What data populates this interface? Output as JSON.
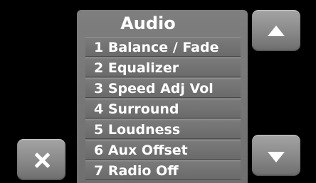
{
  "menu": {
    "title": "Audio",
    "items": [
      {
        "label": "1 Balance / Fade"
      },
      {
        "label": "2 Equalizer"
      },
      {
        "label": "3 Speed Adj Vol"
      },
      {
        "label": "4 Surround"
      },
      {
        "label": "5 Loudness"
      },
      {
        "label": "6 Aux Offset"
      },
      {
        "label": "7 Radio Off"
      }
    ]
  },
  "buttons": {
    "scroll_up_icon": "triangle-up",
    "scroll_down_icon": "triangle-down",
    "close_icon": "x"
  },
  "colors": {
    "background": "#000000",
    "panel": "#777777",
    "text": "#ffffff"
  }
}
